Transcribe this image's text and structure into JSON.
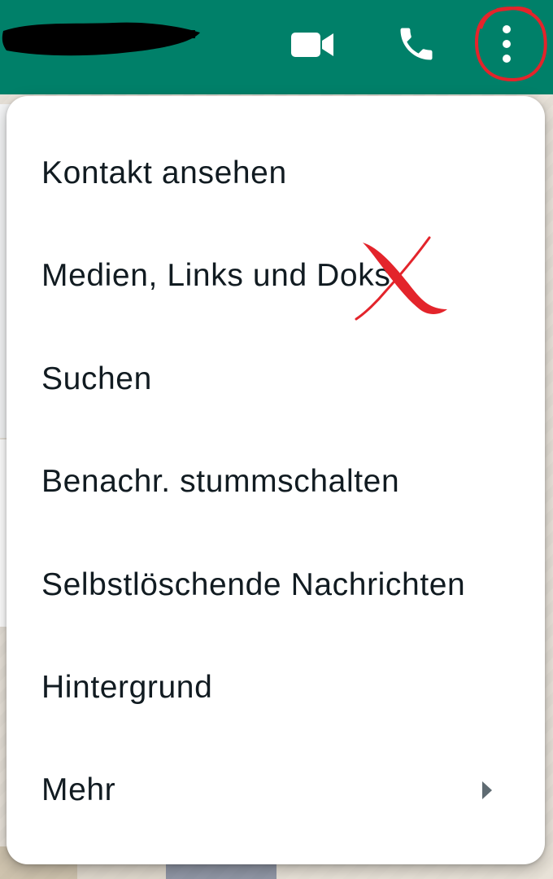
{
  "colors": {
    "brand": "#008069",
    "menu_bg": "#ffffff",
    "menu_text": "#111b21",
    "annotation": "#e3242b"
  },
  "header": {
    "contact_name": "",
    "actions": [
      {
        "icon": "video-camera-icon"
      },
      {
        "icon": "phone-icon"
      },
      {
        "icon": "more-vert-icon"
      }
    ]
  },
  "menu": {
    "items": [
      {
        "label": "Kontakt ansehen"
      },
      {
        "label": "Medien, Links und Doks"
      },
      {
        "label": "Suchen"
      },
      {
        "label": "Benachr. stummschalten"
      },
      {
        "label": "Selbstlöschende Nachrichten"
      },
      {
        "label": "Hintergrund"
      },
      {
        "label": "Mehr",
        "submenu_icon": "arrow-right-icon"
      }
    ]
  }
}
